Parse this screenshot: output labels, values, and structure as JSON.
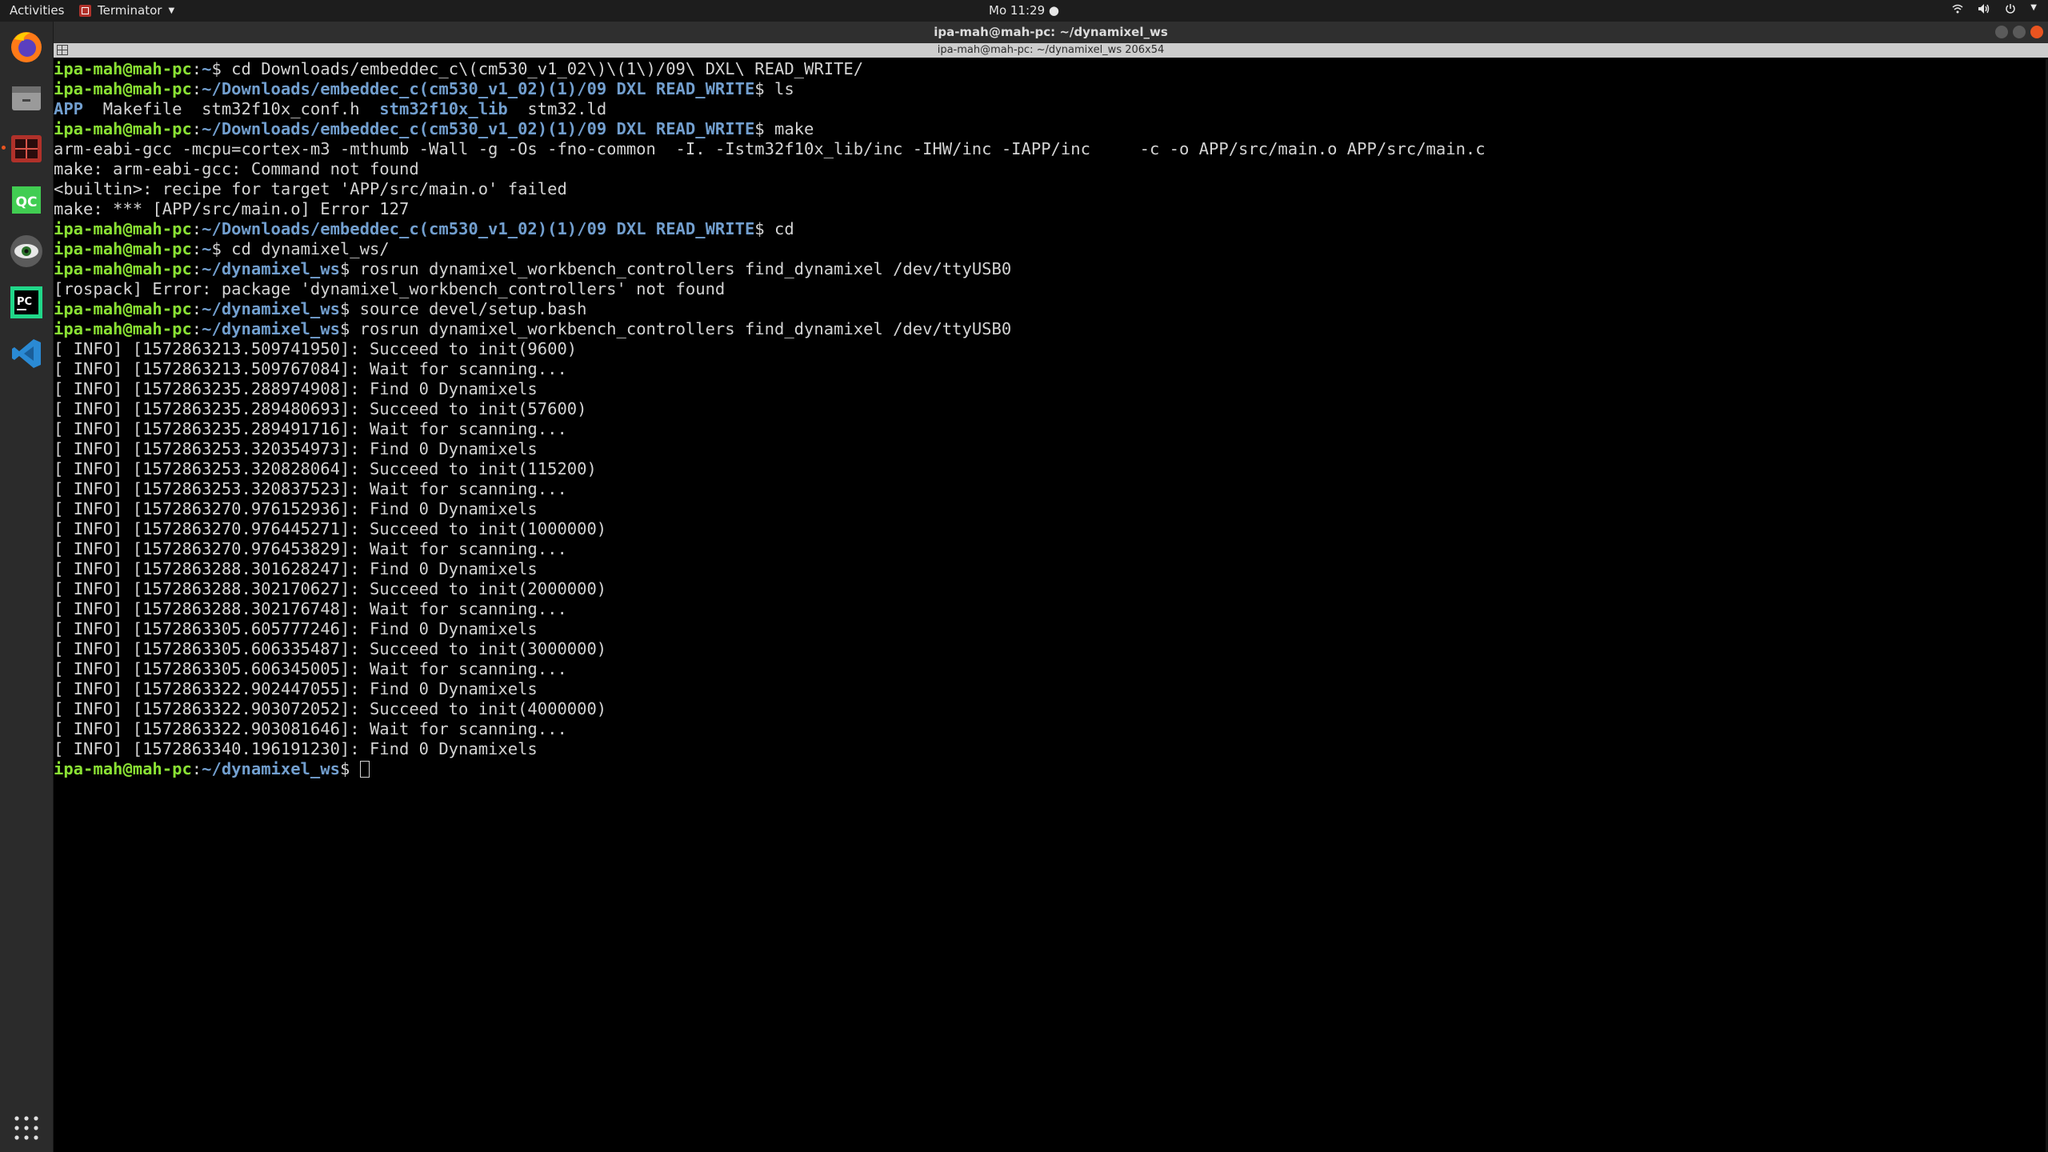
{
  "topbar": {
    "activities": "Activities",
    "app_menu": "Terminator",
    "clock": "Mo 11:29 ●"
  },
  "dock": {
    "items": [
      {
        "name": "firefox-icon",
        "active": false
      },
      {
        "name": "files-icon",
        "active": false
      },
      {
        "name": "terminator-icon",
        "active": true
      },
      {
        "name": "qtcreator-icon",
        "label": "QC",
        "active": false
      },
      {
        "name": "eye-app-icon",
        "active": false
      },
      {
        "name": "pycharm-icon",
        "label": "PC",
        "active": false
      },
      {
        "name": "vscode-icon",
        "active": false
      }
    ],
    "show_apps": "show-applications-icon"
  },
  "window": {
    "title": "ipa-mah@mah-pc: ~/dynamixel_ws",
    "header": "ipa-mah@mah-pc: ~/dynamixel_ws 206x54"
  },
  "colors": {
    "prompt_user": "#8ae234",
    "prompt_path": "#729fcf",
    "directory": "#729fcf",
    "text": "#d3d3d3",
    "background": "#000000",
    "accent": "#e95420"
  },
  "terminal": {
    "lines": [
      [
        {
          "t": "ipa-mah@mah-pc",
          "c": "user"
        },
        {
          "t": ":"
        },
        {
          "t": "~",
          "c": "path"
        },
        {
          "t": "$ cd Downloads/embeddec_c\\(cm530_v1_02\\)\\(1\\)/09\\ DXL\\ READ_WRITE/"
        }
      ],
      [
        {
          "t": "ipa-mah@mah-pc",
          "c": "user"
        },
        {
          "t": ":"
        },
        {
          "t": "~/Downloads/embeddec_c(cm530_v1_02)(1)/09 DXL READ_WRITE",
          "c": "path"
        },
        {
          "t": "$ ls"
        }
      ],
      [
        {
          "t": "APP",
          "c": "dir"
        },
        {
          "t": "  Makefile  stm32f10x_conf.h  "
        },
        {
          "t": "stm32f10x_lib",
          "c": "dir"
        },
        {
          "t": "  stm32.ld"
        }
      ],
      [
        {
          "t": "ipa-mah@mah-pc",
          "c": "user"
        },
        {
          "t": ":"
        },
        {
          "t": "~/Downloads/embeddec_c(cm530_v1_02)(1)/09 DXL READ_WRITE",
          "c": "path"
        },
        {
          "t": "$ make"
        }
      ],
      [
        {
          "t": "arm-eabi-gcc -mcpu=cortex-m3 -mthumb -Wall -g -Os -fno-common  -I. -Istm32f10x_lib/inc -IHW/inc -IAPP/inc     -c -o APP/src/main.o APP/src/main.c"
        }
      ],
      [
        {
          "t": "make: arm-eabi-gcc: Command not found"
        }
      ],
      [
        {
          "t": "<builtin>: recipe for target 'APP/src/main.o' failed"
        }
      ],
      [
        {
          "t": "make: *** [APP/src/main.o] Error 127"
        }
      ],
      [
        {
          "t": "ipa-mah@mah-pc",
          "c": "user"
        },
        {
          "t": ":"
        },
        {
          "t": "~/Downloads/embeddec_c(cm530_v1_02)(1)/09 DXL READ_WRITE",
          "c": "path"
        },
        {
          "t": "$ cd"
        }
      ],
      [
        {
          "t": "ipa-mah@mah-pc",
          "c": "user"
        },
        {
          "t": ":"
        },
        {
          "t": "~",
          "c": "path"
        },
        {
          "t": "$ cd dynamixel_ws/"
        }
      ],
      [
        {
          "t": "ipa-mah@mah-pc",
          "c": "user"
        },
        {
          "t": ":"
        },
        {
          "t": "~/dynamixel_ws",
          "c": "path"
        },
        {
          "t": "$ rosrun dynamixel_workbench_controllers find_dynamixel /dev/ttyUSB0"
        }
      ],
      [
        {
          "t": "[rospack] Error: package 'dynamixel_workbench_controllers' not found"
        }
      ],
      [
        {
          "t": "ipa-mah@mah-pc",
          "c": "user"
        },
        {
          "t": ":"
        },
        {
          "t": "~/dynamixel_ws",
          "c": "path"
        },
        {
          "t": "$ source devel/setup.bash"
        }
      ],
      [
        {
          "t": "ipa-mah@mah-pc",
          "c": "user"
        },
        {
          "t": ":"
        },
        {
          "t": "~/dynamixel_ws",
          "c": "path"
        },
        {
          "t": "$ rosrun dynamixel_workbench_controllers find_dynamixel /dev/ttyUSB0"
        }
      ],
      [
        {
          "t": "[ INFO] [1572863213.509741950]: Succeed to init(9600)"
        }
      ],
      [
        {
          "t": "[ INFO] [1572863213.509767084]: Wait for scanning..."
        }
      ],
      [
        {
          "t": "[ INFO] [1572863235.288974908]: Find 0 Dynamixels"
        }
      ],
      [
        {
          "t": "[ INFO] [1572863235.289480693]: Succeed to init(57600)"
        }
      ],
      [
        {
          "t": "[ INFO] [1572863235.289491716]: Wait for scanning..."
        }
      ],
      [
        {
          "t": "[ INFO] [1572863253.320354973]: Find 0 Dynamixels"
        }
      ],
      [
        {
          "t": "[ INFO] [1572863253.320828064]: Succeed to init(115200)"
        }
      ],
      [
        {
          "t": "[ INFO] [1572863253.320837523]: Wait for scanning..."
        }
      ],
      [
        {
          "t": "[ INFO] [1572863270.976152936]: Find 0 Dynamixels"
        }
      ],
      [
        {
          "t": "[ INFO] [1572863270.976445271]: Succeed to init(1000000)"
        }
      ],
      [
        {
          "t": "[ INFO] [1572863270.976453829]: Wait for scanning..."
        }
      ],
      [
        {
          "t": "[ INFO] [1572863288.301628247]: Find 0 Dynamixels"
        }
      ],
      [
        {
          "t": "[ INFO] [1572863288.302170627]: Succeed to init(2000000)"
        }
      ],
      [
        {
          "t": "[ INFO] [1572863288.302176748]: Wait for scanning..."
        }
      ],
      [
        {
          "t": "[ INFO] [1572863305.605777246]: Find 0 Dynamixels"
        }
      ],
      [
        {
          "t": "[ INFO] [1572863305.606335487]: Succeed to init(3000000)"
        }
      ],
      [
        {
          "t": "[ INFO] [1572863305.606345005]: Wait for scanning..."
        }
      ],
      [
        {
          "t": "[ INFO] [1572863322.902447055]: Find 0 Dynamixels"
        }
      ],
      [
        {
          "t": "[ INFO] [1572863322.903072052]: Succeed to init(4000000)"
        }
      ],
      [
        {
          "t": "[ INFO] [1572863322.903081646]: Wait for scanning..."
        }
      ],
      [
        {
          "t": "[ INFO] [1572863340.196191230]: Find 0 Dynamixels"
        }
      ],
      [
        {
          "t": "ipa-mah@mah-pc",
          "c": "user"
        },
        {
          "t": ":"
        },
        {
          "t": "~/dynamixel_ws",
          "c": "path"
        },
        {
          "t": "$ "
        },
        {
          "cursor": true
        }
      ]
    ]
  }
}
